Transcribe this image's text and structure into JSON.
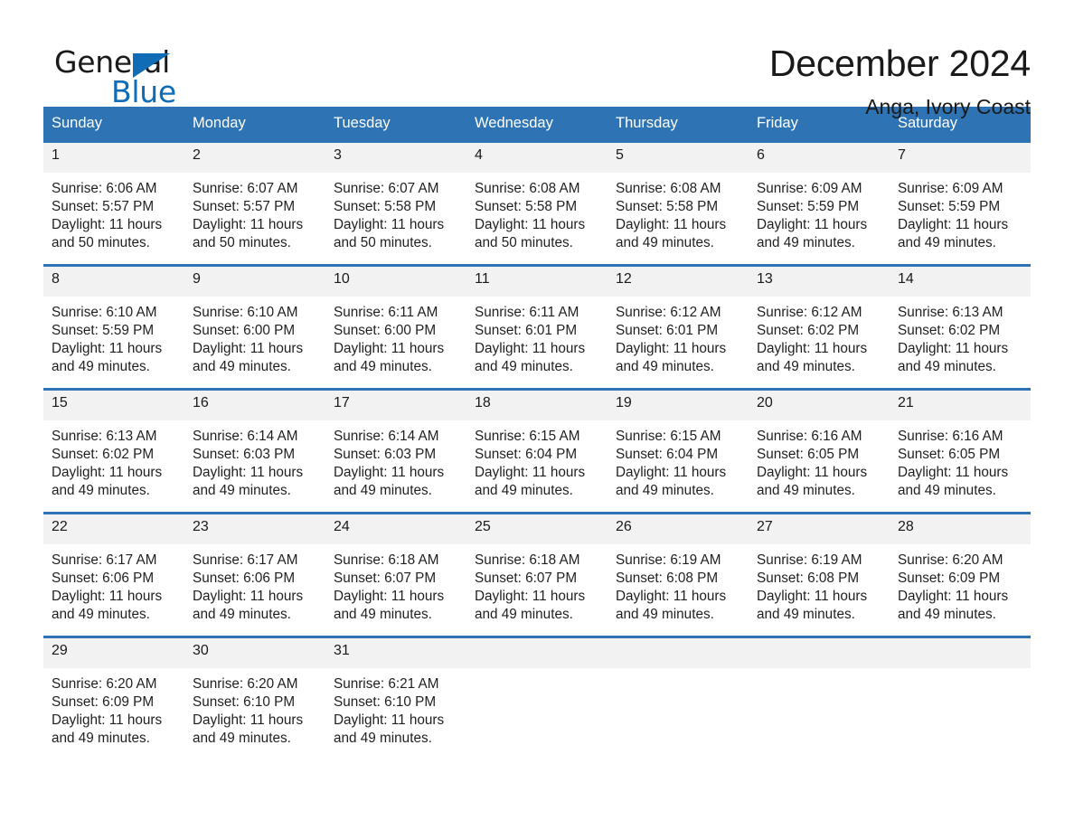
{
  "brand": {
    "name_part1": "General",
    "name_part2": "Blue",
    "accent_color": "#0f6cb5"
  },
  "header": {
    "month_title": "December 2024",
    "location": "Anga, Ivory Coast"
  },
  "theme": {
    "header_blue": "#2e74b5",
    "daynum_background": "#f2f2f2",
    "text_color": "#1a1a1a"
  },
  "calendar": {
    "weekday_headers": [
      "Sunday",
      "Monday",
      "Tuesday",
      "Wednesday",
      "Thursday",
      "Friday",
      "Saturday"
    ],
    "weeks": [
      [
        {
          "day": "1",
          "sunrise": "Sunrise: 6:06 AM",
          "sunset": "Sunset: 5:57 PM",
          "daylight": "Daylight: 11 hours and 50 minutes."
        },
        {
          "day": "2",
          "sunrise": "Sunrise: 6:07 AM",
          "sunset": "Sunset: 5:57 PM",
          "daylight": "Daylight: 11 hours and 50 minutes."
        },
        {
          "day": "3",
          "sunrise": "Sunrise: 6:07 AM",
          "sunset": "Sunset: 5:58 PM",
          "daylight": "Daylight: 11 hours and 50 minutes."
        },
        {
          "day": "4",
          "sunrise": "Sunrise: 6:08 AM",
          "sunset": "Sunset: 5:58 PM",
          "daylight": "Daylight: 11 hours and 50 minutes."
        },
        {
          "day": "5",
          "sunrise": "Sunrise: 6:08 AM",
          "sunset": "Sunset: 5:58 PM",
          "daylight": "Daylight: 11 hours and 49 minutes."
        },
        {
          "day": "6",
          "sunrise": "Sunrise: 6:09 AM",
          "sunset": "Sunset: 5:59 PM",
          "daylight": "Daylight: 11 hours and 49 minutes."
        },
        {
          "day": "7",
          "sunrise": "Sunrise: 6:09 AM",
          "sunset": "Sunset: 5:59 PM",
          "daylight": "Daylight: 11 hours and 49 minutes."
        }
      ],
      [
        {
          "day": "8",
          "sunrise": "Sunrise: 6:10 AM",
          "sunset": "Sunset: 5:59 PM",
          "daylight": "Daylight: 11 hours and 49 minutes."
        },
        {
          "day": "9",
          "sunrise": "Sunrise: 6:10 AM",
          "sunset": "Sunset: 6:00 PM",
          "daylight": "Daylight: 11 hours and 49 minutes."
        },
        {
          "day": "10",
          "sunrise": "Sunrise: 6:11 AM",
          "sunset": "Sunset: 6:00 PM",
          "daylight": "Daylight: 11 hours and 49 minutes."
        },
        {
          "day": "11",
          "sunrise": "Sunrise: 6:11 AM",
          "sunset": "Sunset: 6:01 PM",
          "daylight": "Daylight: 11 hours and 49 minutes."
        },
        {
          "day": "12",
          "sunrise": "Sunrise: 6:12 AM",
          "sunset": "Sunset: 6:01 PM",
          "daylight": "Daylight: 11 hours and 49 minutes."
        },
        {
          "day": "13",
          "sunrise": "Sunrise: 6:12 AM",
          "sunset": "Sunset: 6:02 PM",
          "daylight": "Daylight: 11 hours and 49 minutes."
        },
        {
          "day": "14",
          "sunrise": "Sunrise: 6:13 AM",
          "sunset": "Sunset: 6:02 PM",
          "daylight": "Daylight: 11 hours and 49 minutes."
        }
      ],
      [
        {
          "day": "15",
          "sunrise": "Sunrise: 6:13 AM",
          "sunset": "Sunset: 6:02 PM",
          "daylight": "Daylight: 11 hours and 49 minutes."
        },
        {
          "day": "16",
          "sunrise": "Sunrise: 6:14 AM",
          "sunset": "Sunset: 6:03 PM",
          "daylight": "Daylight: 11 hours and 49 minutes."
        },
        {
          "day": "17",
          "sunrise": "Sunrise: 6:14 AM",
          "sunset": "Sunset: 6:03 PM",
          "daylight": "Daylight: 11 hours and 49 minutes."
        },
        {
          "day": "18",
          "sunrise": "Sunrise: 6:15 AM",
          "sunset": "Sunset: 6:04 PM",
          "daylight": "Daylight: 11 hours and 49 minutes."
        },
        {
          "day": "19",
          "sunrise": "Sunrise: 6:15 AM",
          "sunset": "Sunset: 6:04 PM",
          "daylight": "Daylight: 11 hours and 49 minutes."
        },
        {
          "day": "20",
          "sunrise": "Sunrise: 6:16 AM",
          "sunset": "Sunset: 6:05 PM",
          "daylight": "Daylight: 11 hours and 49 minutes."
        },
        {
          "day": "21",
          "sunrise": "Sunrise: 6:16 AM",
          "sunset": "Sunset: 6:05 PM",
          "daylight": "Daylight: 11 hours and 49 minutes."
        }
      ],
      [
        {
          "day": "22",
          "sunrise": "Sunrise: 6:17 AM",
          "sunset": "Sunset: 6:06 PM",
          "daylight": "Daylight: 11 hours and 49 minutes."
        },
        {
          "day": "23",
          "sunrise": "Sunrise: 6:17 AM",
          "sunset": "Sunset: 6:06 PM",
          "daylight": "Daylight: 11 hours and 49 minutes."
        },
        {
          "day": "24",
          "sunrise": "Sunrise: 6:18 AM",
          "sunset": "Sunset: 6:07 PM",
          "daylight": "Daylight: 11 hours and 49 minutes."
        },
        {
          "day": "25",
          "sunrise": "Sunrise: 6:18 AM",
          "sunset": "Sunset: 6:07 PM",
          "daylight": "Daylight: 11 hours and 49 minutes."
        },
        {
          "day": "26",
          "sunrise": "Sunrise: 6:19 AM",
          "sunset": "Sunset: 6:08 PM",
          "daylight": "Daylight: 11 hours and 49 minutes."
        },
        {
          "day": "27",
          "sunrise": "Sunrise: 6:19 AM",
          "sunset": "Sunset: 6:08 PM",
          "daylight": "Daylight: 11 hours and 49 minutes."
        },
        {
          "day": "28",
          "sunrise": "Sunrise: 6:20 AM",
          "sunset": "Sunset: 6:09 PM",
          "daylight": "Daylight: 11 hours and 49 minutes."
        }
      ],
      [
        {
          "day": "29",
          "sunrise": "Sunrise: 6:20 AM",
          "sunset": "Sunset: 6:09 PM",
          "daylight": "Daylight: 11 hours and 49 minutes."
        },
        {
          "day": "30",
          "sunrise": "Sunrise: 6:20 AM",
          "sunset": "Sunset: 6:10 PM",
          "daylight": "Daylight: 11 hours and 49 minutes."
        },
        {
          "day": "31",
          "sunrise": "Sunrise: 6:21 AM",
          "sunset": "Sunset: 6:10 PM",
          "daylight": "Daylight: 11 hours and 49 minutes."
        },
        {
          "day": "",
          "sunrise": "",
          "sunset": "",
          "daylight": ""
        },
        {
          "day": "",
          "sunrise": "",
          "sunset": "",
          "daylight": ""
        },
        {
          "day": "",
          "sunrise": "",
          "sunset": "",
          "daylight": ""
        },
        {
          "day": "",
          "sunrise": "",
          "sunset": "",
          "daylight": ""
        }
      ]
    ]
  }
}
